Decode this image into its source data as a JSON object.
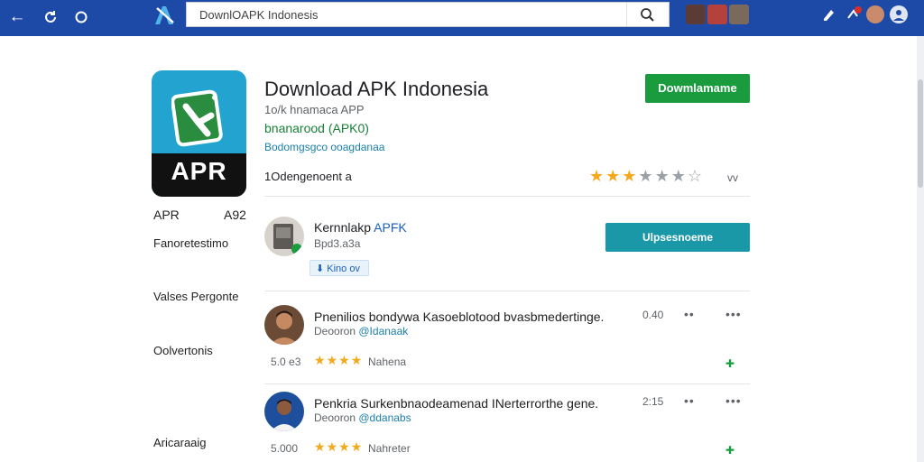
{
  "search": {
    "value": "DownlOAPK Indonesis"
  },
  "app": {
    "icon_label": "APR",
    "title": "Download APK Indonesia",
    "subtitle": "1o/k hnamaca APP",
    "version_line": "bnanarood (APK0)",
    "category_line": "Bodomgsgco ooagdanaa",
    "developer": "1Odengenoent a",
    "rating_stars": 3,
    "rating_max": 7,
    "chevron": "vv",
    "install_label": "Dowmlamame"
  },
  "sidebar": {
    "label_left": "APR",
    "label_right": "A92",
    "items": [
      "Fanoretestimo",
      "Valses Pergonte",
      "Oolvertonis",
      "Aricaraaig"
    ]
  },
  "featured": {
    "title": "Kernnlakp",
    "title_link": "APFK",
    "sub": "Bpd3.a3a",
    "chip_label": "Kino ov",
    "button_label": "Ulpsesnoeme"
  },
  "reviews": [
    {
      "text": "Pnenilios bondywa Kasoeblotood bvasbmedertinge.",
      "handle_prefix": "Deooron",
      "handle_link": "@Idanaak",
      "time": "0.40",
      "score": "5.0 e3",
      "stars": 4,
      "author": "Nahena"
    },
    {
      "text": "Penkria Surkenbnaodeamenad INerterrorthe gene.",
      "handle_prefix": "Deooron",
      "handle_link": "@ddanabs",
      "time": "2:15",
      "score": "5.000",
      "stars": 4,
      "author": "Nahreter"
    }
  ],
  "colors": {
    "topbar": "#1d4aa6",
    "install": "#1a9c3e",
    "update": "#1a98a8",
    "star": "#f4a81c"
  }
}
